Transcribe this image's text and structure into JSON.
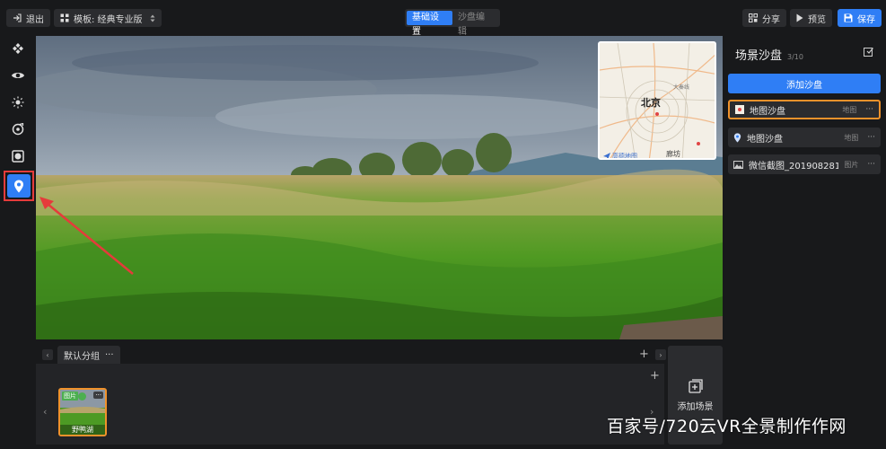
{
  "topbar": {
    "exit_label": "退出",
    "template_label": "模板: 经典专业版",
    "tabs": [
      {
        "label": "基础设置",
        "active": true
      },
      {
        "label": "沙盘编辑",
        "active": false
      }
    ],
    "share_label": "分享",
    "preview_label": "预览",
    "save_label": "保存"
  },
  "rail": {
    "items": [
      {
        "icon": "hotspot-icon"
      },
      {
        "icon": "eye-icon"
      },
      {
        "icon": "sun-icon"
      },
      {
        "icon": "music-icon"
      },
      {
        "icon": "mask-icon"
      },
      {
        "icon": "map-pin-icon",
        "selected": true
      }
    ]
  },
  "minimap": {
    "city": "北京",
    "sub_label": "廊坊",
    "brand": "高德地图",
    "road_label": "大秦线"
  },
  "bottom": {
    "group_tab": "默认分组",
    "group_more": "···",
    "thumb": {
      "tag": "图片",
      "more": "···",
      "label": "野鸭湖"
    },
    "add_scene_label": "添加场景"
  },
  "right_panel": {
    "title": "场景沙盘",
    "count": "3/10",
    "add_button": "添加沙盘",
    "items": [
      {
        "icon": "map-thumb-icon",
        "name": "地图沙盘",
        "type": "地图",
        "more": "···",
        "active": true
      },
      {
        "icon": "map-pin-icon",
        "name": "地图沙盘",
        "type": "地图",
        "more": "···",
        "active": false
      },
      {
        "icon": "image-icon",
        "name": "微信截图_201908281...",
        "type": "图片",
        "more": "···",
        "active": false
      }
    ]
  },
  "watermark": "百家号/720云VR全景制作作网",
  "colors": {
    "accent": "#2f7ef5",
    "highlight": "#f0922b",
    "annotation": "#e53b3b"
  }
}
